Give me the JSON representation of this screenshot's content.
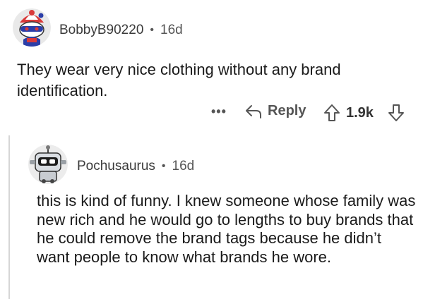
{
  "comment": {
    "username": "BobbyB90220",
    "separator": "•",
    "age": "16d",
    "text": "They wear very nice clothing without any brand identification.",
    "actions": {
      "more_label": "•••",
      "reply_label": "Reply",
      "score": "1.9k"
    },
    "avatar_icon": "snoo-avatar-jester-icon"
  },
  "reply": {
    "username": "Pochusaurus",
    "separator": "•",
    "age": "16d",
    "text": "this is kind of funny. I knew someone whose family was new rich and he would go to lengths to buy brands that he could remove the brand tags because he didn’t want people to know what brands he wore.",
    "avatar_icon": "snoo-avatar-robot-icon"
  },
  "colors": {
    "background": "#ffffff",
    "text": "#1a1a1a",
    "meta": "#555555",
    "thread_line": "#d6d6d6"
  }
}
